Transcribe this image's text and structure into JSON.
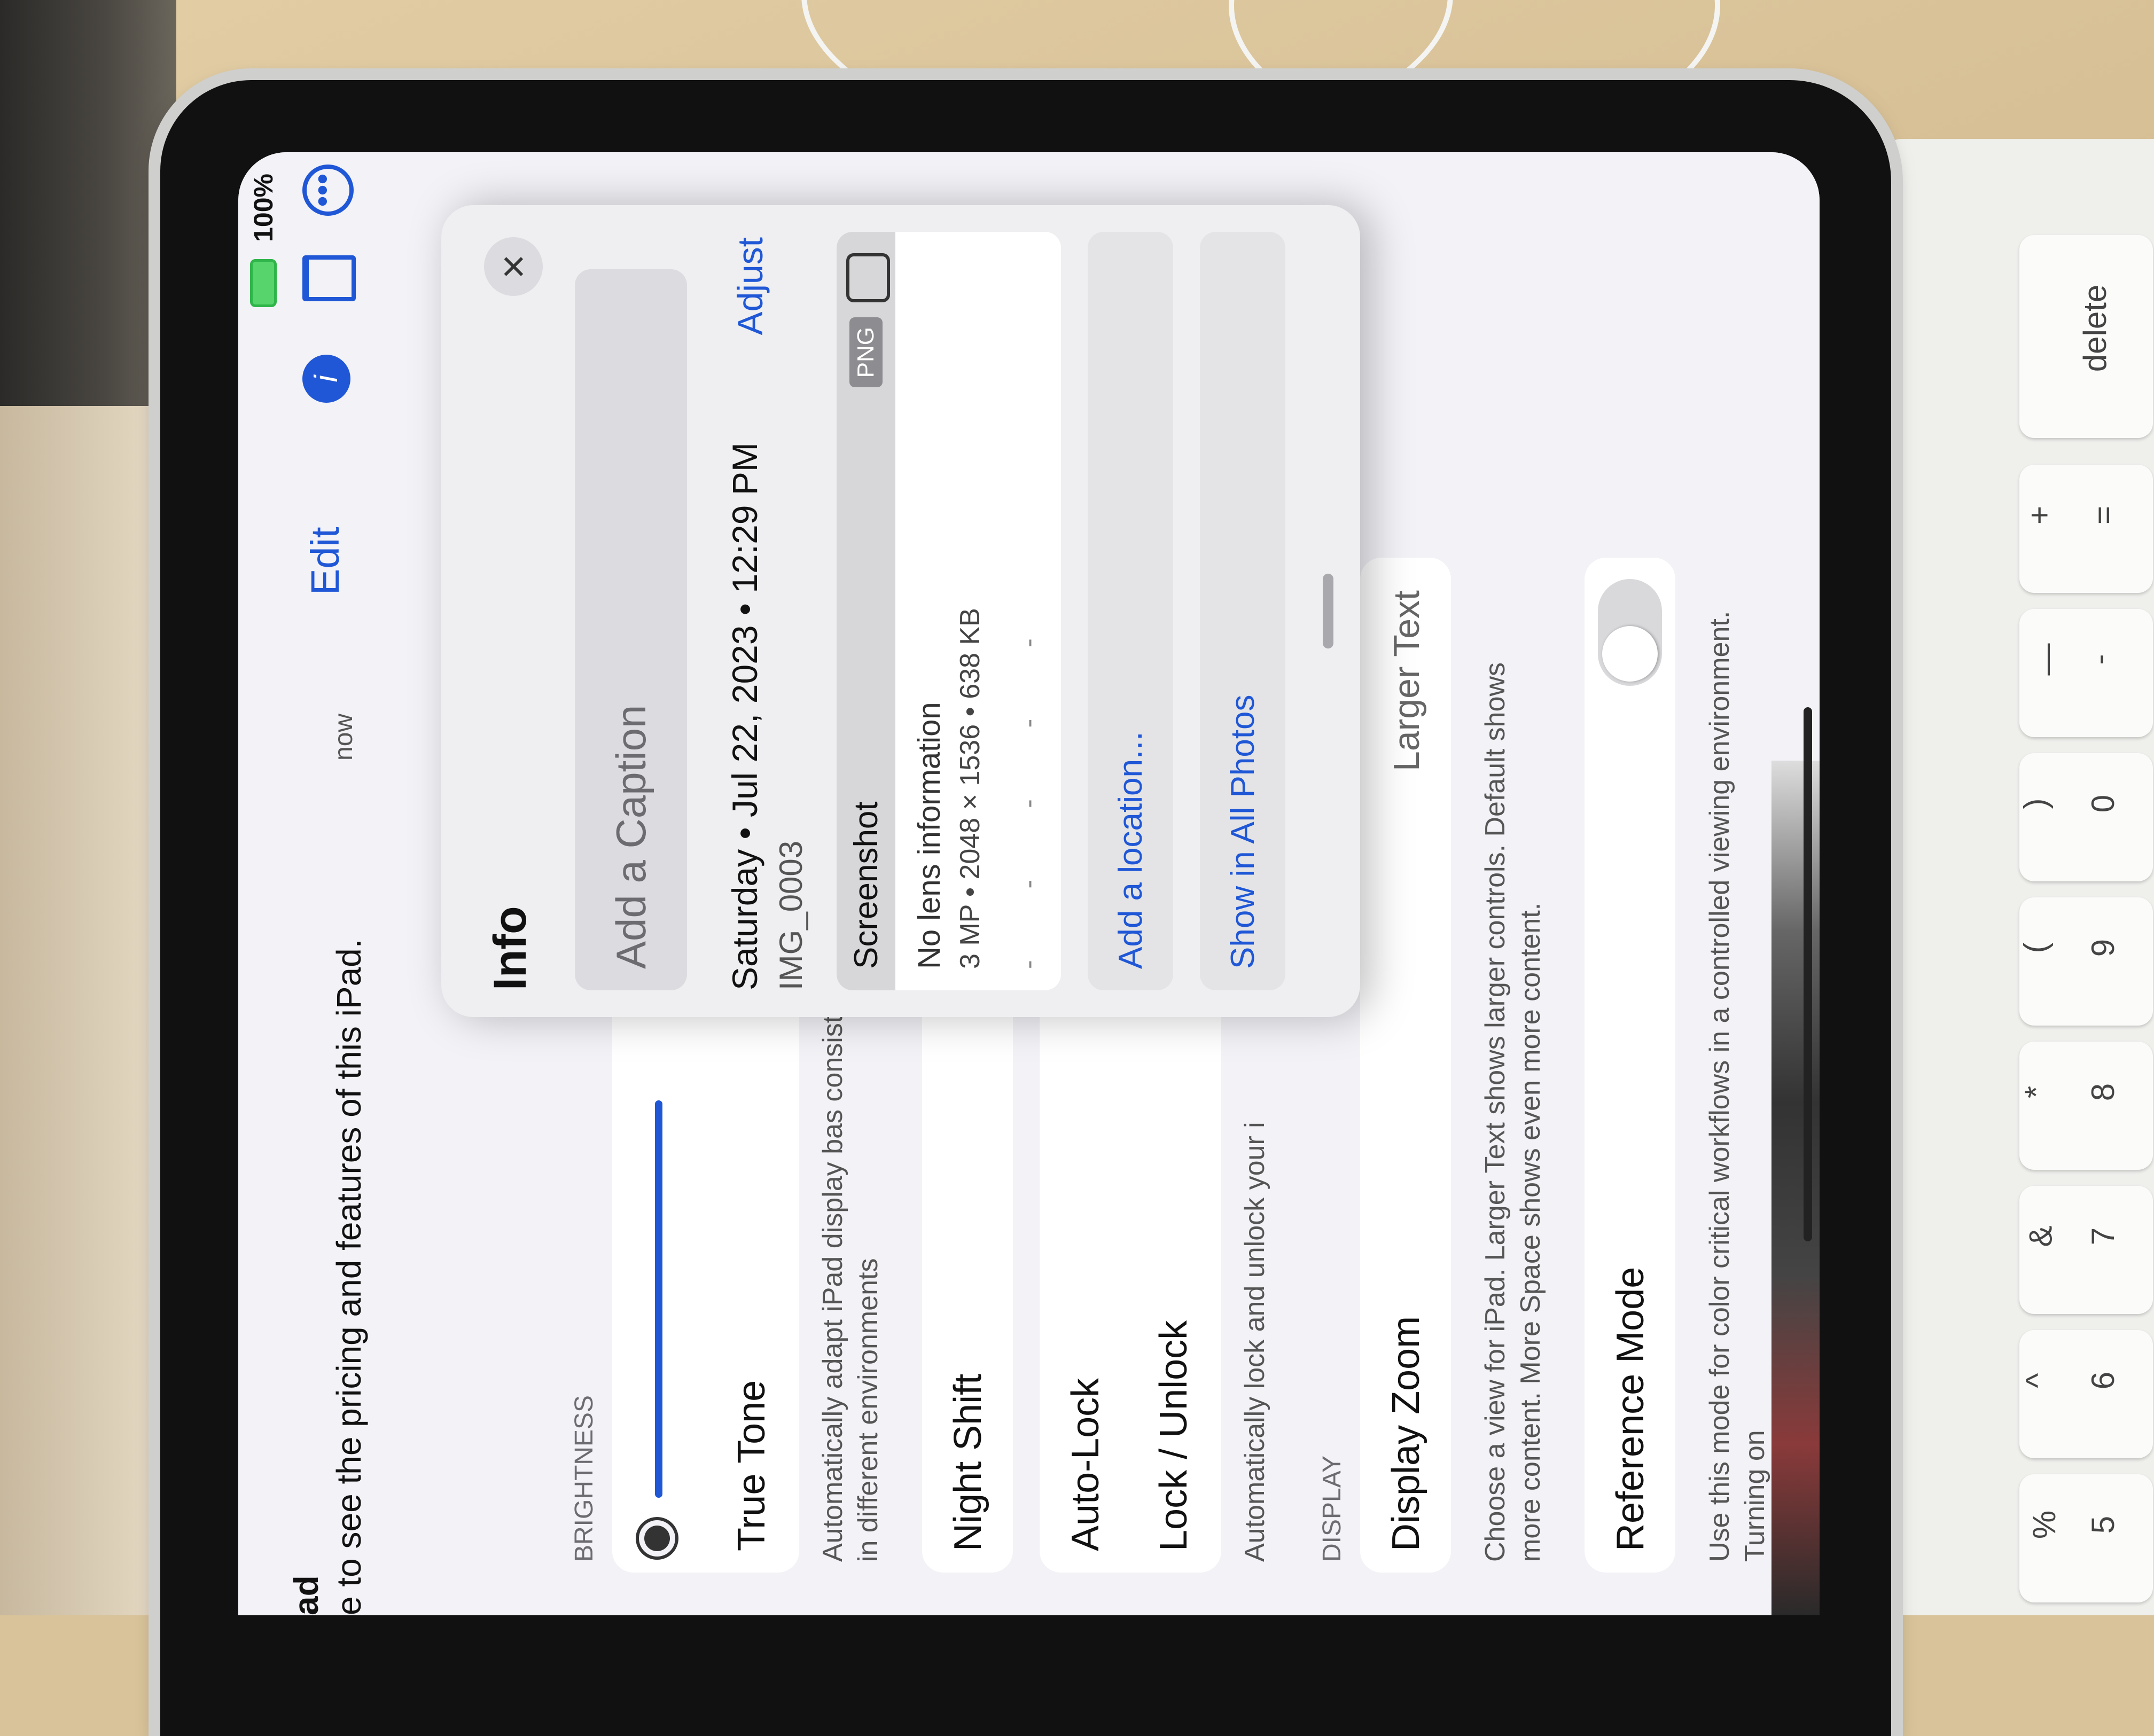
{
  "status": {
    "battery": "100%"
  },
  "toolbar": {
    "edit": "Edit",
    "info": "i",
    "more": "•••"
  },
  "banner": {
    "title": "ad",
    "text": "e to see the pricing and features of this iPad.",
    "time": "now"
  },
  "settings": {
    "brightness_header": "BRIGHTNESS",
    "brightness_level": 0.62,
    "true_tone": "True Tone",
    "true_tone_note": "Automatically adapt iPad display bas consistent in different environments",
    "night_shift": "Night Shift",
    "auto_lock": "Auto-Lock",
    "lock_unlock": "Lock / Unlock",
    "lock_note": "Automatically lock and unlock your i",
    "display_header": "DISPLAY",
    "display_zoom": "Display Zoom",
    "display_zoom_value": "Larger Text",
    "display_zoom_note": "Choose a view for iPad. Larger Text shows larger controls. Default shows more content. More Space shows even more content.",
    "reference_mode": "Reference Mode",
    "reference_note": "Use this mode for color critical workflows in a controlled viewing environment. Turning on"
  },
  "info": {
    "title": "Info",
    "caption_placeholder": "Add a Caption",
    "date": "Saturday • Jul 22, 2023 • 12:29 PM",
    "filename": "IMG_0003",
    "adjust": "Adjust",
    "type": "Screenshot",
    "format_badge": "PNG",
    "lens": "No lens information",
    "dimensions": "3 MP • 2048 × 1536 • 638 KB",
    "exif_placeholders": "- - - - -",
    "add_location": "Add a location...",
    "show_all": "Show in All Photos"
  },
  "keyboard": {
    "keys": [
      {
        "top": "%",
        "bottom": "5"
      },
      {
        "top": "^",
        "bottom": "6"
      },
      {
        "top": "&",
        "bottom": "7"
      },
      {
        "top": "*",
        "bottom": "8"
      },
      {
        "top": "(",
        "bottom": "9"
      },
      {
        "top": ")",
        "bottom": "0"
      },
      {
        "top": "—",
        "bottom": "-"
      },
      {
        "top": "+",
        "bottom": "="
      },
      {
        "top": "",
        "bottom": "delete"
      }
    ]
  }
}
